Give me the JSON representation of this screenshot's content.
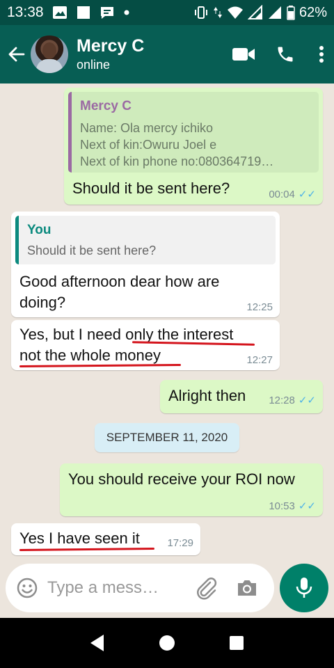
{
  "status_bar": {
    "time": "13:38",
    "battery": "62%"
  },
  "header": {
    "contact_name": "Mercy C",
    "contact_status": "online"
  },
  "messages": [
    {
      "direction": "outgoing",
      "quote": {
        "author": "Mercy C",
        "lines": [
          "Name: Ola mercy ichiko",
          "Next of kin:Owuru Joel e",
          "Next of kin phone no:080364719…"
        ]
      },
      "text": "Should it be sent here?",
      "time": "00:04",
      "status": "read"
    },
    {
      "direction": "incoming",
      "quote": {
        "author": "You",
        "lines": [
          "Should it be sent here?"
        ]
      },
      "text_lines": [
        "Good afternoon dear how are",
        "doing?"
      ],
      "time": "12:25"
    },
    {
      "direction": "incoming",
      "text_lines": [
        "Yes, but I need only the interest",
        "not the whole money"
      ],
      "time": "12:27"
    },
    {
      "direction": "outgoing",
      "text": "Alright then",
      "time": "12:28",
      "status": "read"
    },
    {
      "direction": "outgoing",
      "text": "You should receive your ROI now",
      "time": "10:53",
      "status": "read"
    },
    {
      "direction": "incoming",
      "text": "Yes I have seen it",
      "time": "17:29"
    }
  ],
  "date_divider": "SEPTEMBER 11, 2020",
  "composer": {
    "placeholder": "Type a mess…"
  },
  "icons": {
    "back": "arrow-left-icon",
    "video": "video-camera-icon",
    "call": "phone-icon",
    "menu": "more-vert-icon",
    "emoji": "emoji-icon",
    "attach": "paperclip-icon",
    "camera": "camera-icon",
    "mic": "microphone-icon"
  },
  "colors": {
    "header": "#075e54",
    "status_bar": "#054d44",
    "chat_bg": "#ece5dd",
    "outgoing_bubble": "#dcf8c6",
    "incoming_bubble": "#ffffff",
    "read_ticks": "#4fb3e8",
    "mercy_quote_accent": "#9b6aa3",
    "you_quote_accent": "#0b8a7e",
    "mic_button": "#008069",
    "underline": "#d4141c"
  }
}
